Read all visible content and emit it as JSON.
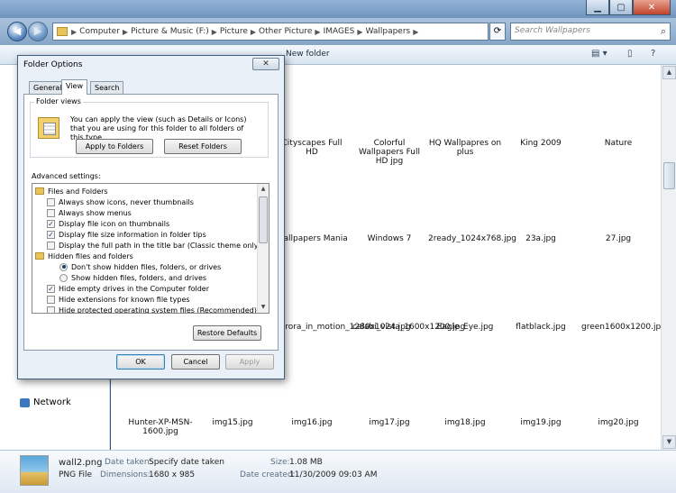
{
  "address": {
    "crumbs": [
      "Computer",
      "Picture & Music (F:)",
      "Picture",
      "Other Picture",
      "IMAGES",
      "Wallpapers"
    ],
    "search_placeholder": "Search Wallpapers"
  },
  "toolbar": {
    "new_folder": "New folder"
  },
  "navpane": {
    "network": "Network"
  },
  "files": [
    {
      "label": "Cityscapes Full HD"
    },
    {
      "label": "Colorful Wallpapers Full HD jpg"
    },
    {
      "label": "HQ  Wallpapres on plus"
    },
    {
      "label": "King 2009"
    },
    {
      "label": "Nature"
    },
    {
      "label": "Wallpapers Mania"
    },
    {
      "label": "Windows 7"
    },
    {
      "label": "2ready_1024x768.jpg"
    },
    {
      "label": "23a.jpg"
    },
    {
      "label": "27.jpg"
    },
    {
      "label": "aurora_in_motion_1280x1024.jpg"
    },
    {
      "label": "calabi_vista_1600x1200.jpg"
    },
    {
      "label": "Eagle_Eye.jpg"
    },
    {
      "label": "flatblack.jpg"
    },
    {
      "label": "green1600x1200.jpg"
    },
    {
      "label": "Hunter-XP-MSN-1600.jpg"
    },
    {
      "label": "img15.jpg"
    },
    {
      "label": "img16.jpg"
    },
    {
      "label": "img17.jpg"
    },
    {
      "label": "img18.jpg"
    },
    {
      "label": "img19.jpg"
    },
    {
      "label": "img20.jpg"
    }
  ],
  "details": {
    "filename": "wall2.png",
    "filetype": "PNG File",
    "date_taken_key": "Date taken:",
    "date_taken_val": "Specify date taken",
    "dimensions_key": "Dimensions:",
    "dimensions_val": "1680 x 985",
    "size_key": "Size:",
    "size_val": "1.08 MB",
    "created_key": "Date created:",
    "created_val": "11/30/2009 09:03 AM"
  },
  "dialog": {
    "title": "Folder Options",
    "close_label": "✕",
    "tabs": [
      "General",
      "View",
      "Search"
    ],
    "folder_views_title": "Folder views",
    "folder_views_text": "You can apply the view (such as Details or Icons) that you are using for this folder to all folders of this type.",
    "apply_to_folders": "Apply to Folders",
    "reset_folders": "Reset Folders",
    "advanced_label": "Advanced settings:",
    "tree": [
      {
        "type": "folder",
        "label": "Files and Folders"
      },
      {
        "type": "checkbox",
        "checked": false,
        "label": "Always show icons, never thumbnails"
      },
      {
        "type": "checkbox",
        "checked": false,
        "label": "Always show menus"
      },
      {
        "type": "checkbox",
        "checked": true,
        "label": "Display file icon on thumbnails"
      },
      {
        "type": "checkbox",
        "checked": true,
        "label": "Display file size information in folder tips"
      },
      {
        "type": "checkbox",
        "checked": false,
        "label": "Display the full path in the title bar (Classic theme only)"
      },
      {
        "type": "folder",
        "label": "Hidden files and folders"
      },
      {
        "type": "radio",
        "checked": true,
        "label": "Don't show hidden files, folders, or drives"
      },
      {
        "type": "radio",
        "checked": false,
        "label": "Show hidden files, folders, and drives"
      },
      {
        "type": "checkbox",
        "checked": true,
        "label": "Hide empty drives in the Computer folder"
      },
      {
        "type": "checkbox",
        "checked": false,
        "label": "Hide extensions for known file types"
      },
      {
        "type": "checkbox",
        "checked": false,
        "label": "Hide protected operating system files (Recommended)"
      }
    ],
    "restore_defaults": "Restore Defaults",
    "ok": "OK",
    "cancel": "Cancel",
    "apply": "Apply"
  }
}
